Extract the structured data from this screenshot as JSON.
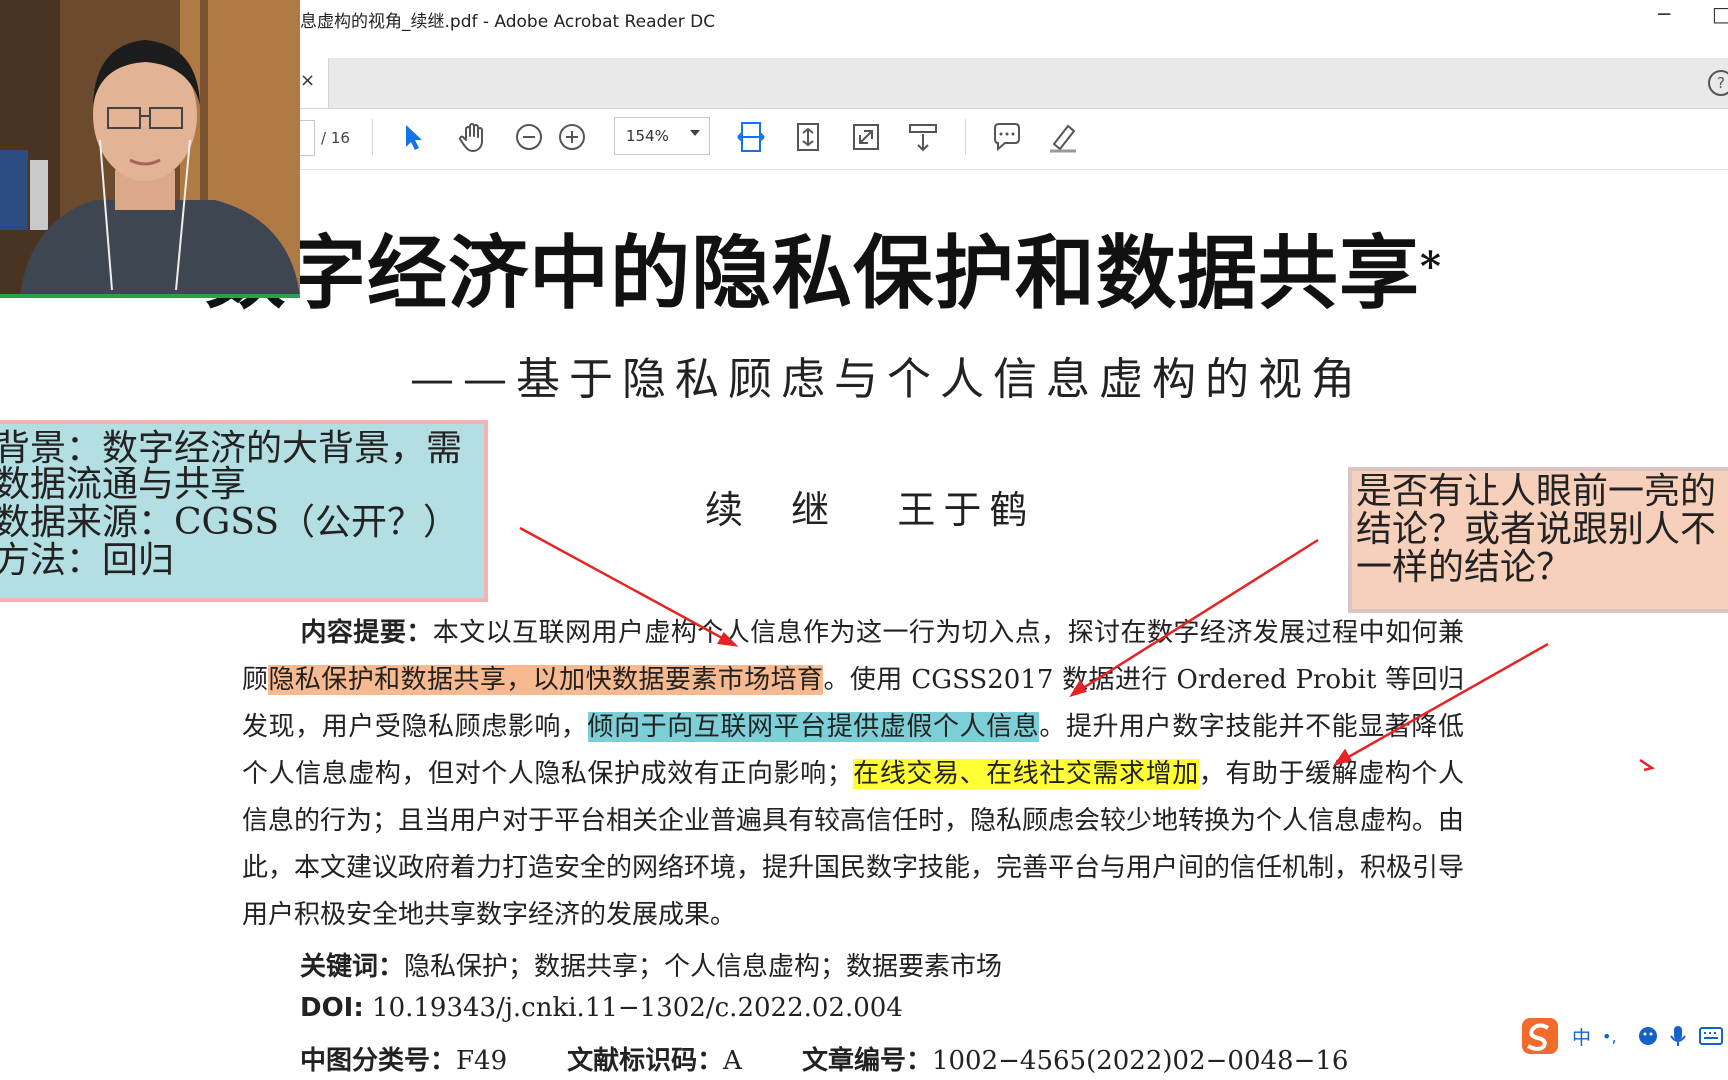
{
  "window": {
    "title": "息虚构的视角_续继.pdf - Adobe Acrobat Reader DC",
    "minimize": "─",
    "restore": "□"
  },
  "tabbar": {
    "close": "×",
    "help": "?"
  },
  "toolbar": {
    "page_total": "/ 16",
    "zoom": "154%",
    "icons": [
      "select-arrow-icon",
      "hand-icon",
      "zoom-out-icon",
      "zoom-in-icon",
      "fit-width-icon",
      "fit-page-icon",
      "full-screen-icon",
      "scroll-mode-icon",
      "comment-icon",
      "highlight-pen-icon"
    ]
  },
  "document": {
    "title": "数字经济中的隐私保护和数据共享",
    "title_mark": "*",
    "subtitle": "——基于隐私顾虑与个人信息虚构的视角",
    "authors": "续  继   王于鹤",
    "abstract": {
      "label": "内容提要：",
      "p1": "本文以互联网用户虚构个人信息作为这一行为切入点，探讨在数字经济发展过程中如何兼顾",
      "hl1": "隐私保护和数据共享，以加快数据要素市场培育",
      "p2": "。使用 CGSS2017 数据进行 Ordered Probit 等回归发现，用户受隐私顾虑影响，",
      "hl2": "倾向于向互联网平台提供虚假个人信息",
      "p3": "。提升用户数字技能并不能显著降低个人信息虚构，但对个人隐私保护成效有正向影响；",
      "hl3": "在线交易、在线社交需求增加",
      "p4": "，有助于缓解虚构个人信息的行为；且当用户对于平台相关企业普遍具有较高信任时，隐私顾虑会较少地转换为个人信息虚构。由此，本文建议政府着力打造安全的网络环境，提升国民数字技能，完善平台与用户间的信任机制，积极引导用户积极安全地共享数字经济的发展成果。"
    },
    "keywords_label": "关键词：",
    "keywords": "隐私保护；数据共享；个人信息虚构；数据要素市场",
    "doi_label": "DOI:",
    "doi": " 10.19343/j.cnki.11−1302/c.2022.02.004",
    "clc_label": "中图分类号：",
    "clc": "F49",
    "doc_code_label": "文献标识码：",
    "doc_code": "A",
    "article_no_label": "文章编号：",
    "article_no": "1002−4565(2022)02−0048−16"
  },
  "annotations": {
    "left_note": [
      "背景：数字经济的大背景，需",
      "数据流通与共享",
      "数据来源：CGSS（公开？）",
      "方法：回归"
    ],
    "right_note": [
      "是否有让人眼前一亮的",
      "结论？或者说跟别人不",
      "一样的结论？"
    ]
  },
  "ime": {
    "mode": "中",
    "punct": "•,"
  },
  "colors": {
    "highlight_orange": "#f7b98f",
    "highlight_blue": "#7ccfd6",
    "highlight_yellow": "#ffff33",
    "arrow_red": "#e52525",
    "note_left_bg": "#b3dfe3",
    "note_right_bg": "#f7d0bc",
    "acrobat_blue": "#1473e6"
  }
}
